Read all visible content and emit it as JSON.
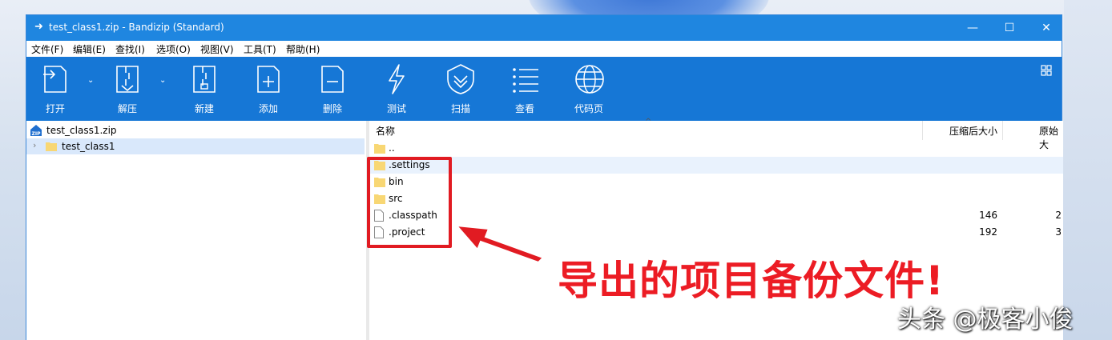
{
  "window": {
    "title": "test_class1.zip - Bandizip (Standard)",
    "controls": {
      "minimize": "—",
      "maximize": "☐",
      "close": "✕"
    }
  },
  "menu": [
    "文件(F)",
    "编辑(E)",
    "查找(I)",
    "选项(O)",
    "视图(V)",
    "工具(T)",
    "帮助(H)"
  ],
  "toolbar": {
    "open": "打开",
    "extract": "解压",
    "new": "新建",
    "add": "添加",
    "delete": "删除",
    "test": "测试",
    "scan": "扫描",
    "view": "查看",
    "codepage": "代码页"
  },
  "tree": {
    "root": "test_class1.zip",
    "child": "test_class1",
    "zip_badge": "ZIP"
  },
  "columns": {
    "name": "名称",
    "compressed": "压缩后大小",
    "original": "原始大"
  },
  "files": [
    {
      "name": "..",
      "type": "folder",
      "compressed": "",
      "original": ""
    },
    {
      "name": ".settings",
      "type": "folder",
      "compressed": "",
      "original": ""
    },
    {
      "name": "bin",
      "type": "folder",
      "compressed": "",
      "original": ""
    },
    {
      "name": "src",
      "type": "folder",
      "compressed": "",
      "original": ""
    },
    {
      "name": ".classpath",
      "type": "file",
      "compressed": "146",
      "original": "2"
    },
    {
      "name": ".project",
      "type": "file",
      "compressed": "192",
      "original": "3"
    }
  ],
  "annotation": "导出的项目备份文件!",
  "watermark": "头条 @极客小俊",
  "colors": {
    "titlebar": "#1f86e0",
    "toolbar": "#1677d6",
    "highlight": "#e11b22",
    "annotation": "#ec1c24",
    "folder": "#f8d774"
  }
}
